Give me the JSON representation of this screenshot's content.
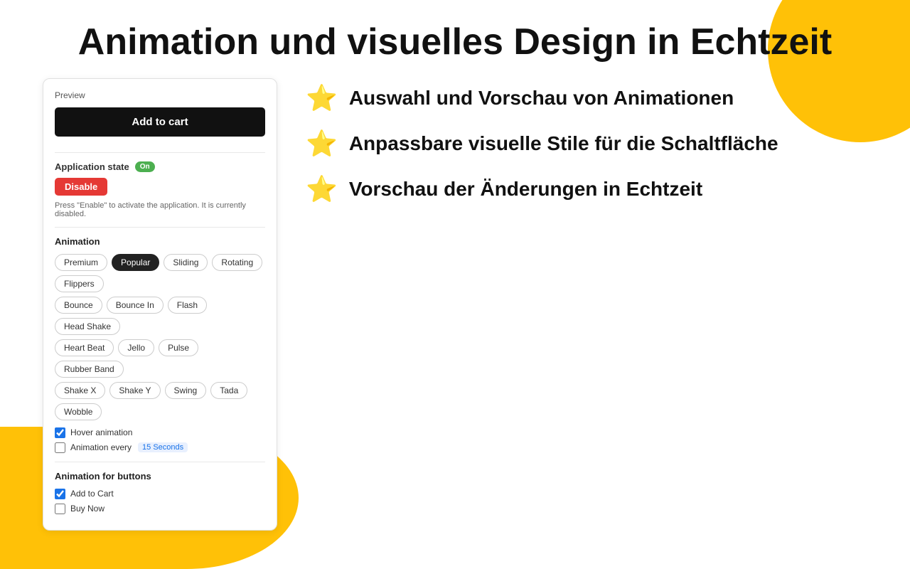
{
  "page": {
    "title": "Animation und visuelles Design in Echtzeit"
  },
  "blob": {
    "top_right": true,
    "bottom_left": true
  },
  "ui_card": {
    "preview_label": "Preview",
    "add_to_cart_label": "Add to cart",
    "application_state": {
      "label": "Application state",
      "badge": "On",
      "disable_button": "Disable",
      "hint": "Press \"Enable\" to activate the application. It is currently disabled."
    },
    "animation_section": {
      "title": "Animation",
      "tabs": [
        {
          "label": "Premium",
          "active": false
        },
        {
          "label": "Popular",
          "active": true
        },
        {
          "label": "Sliding",
          "active": false
        },
        {
          "label": "Rotating",
          "active": false
        },
        {
          "label": "Flippers",
          "active": false
        }
      ],
      "tags_row1": [
        {
          "label": "Bounce",
          "active": false
        },
        {
          "label": "Bounce In",
          "active": false
        },
        {
          "label": "Flash",
          "active": false
        },
        {
          "label": "Head Shake",
          "active": false
        }
      ],
      "tags_row2": [
        {
          "label": "Heart Beat",
          "active": false
        },
        {
          "label": "Jello",
          "active": false
        },
        {
          "label": "Pulse",
          "active": false
        },
        {
          "label": "Rubber Band",
          "active": false
        }
      ],
      "tags_row3": [
        {
          "label": "Shake X",
          "active": false
        },
        {
          "label": "Shake Y",
          "active": false
        },
        {
          "label": "Swing",
          "active": false
        },
        {
          "label": "Tada",
          "active": false
        },
        {
          "label": "Wobble",
          "active": false
        }
      ],
      "hover_animation": {
        "label": "Hover animation",
        "checked": true
      },
      "animation_every": {
        "label": "Animation every",
        "seconds_label": "15 Seconds",
        "checked": false
      }
    },
    "animation_for_buttons": {
      "title": "Animation for buttons",
      "buttons": [
        {
          "label": "Add to Cart",
          "checked": true
        },
        {
          "label": "Buy Now",
          "checked": false
        }
      ]
    }
  },
  "features": [
    {
      "icon": "⭐",
      "text": "Auswahl und Vorschau von Animationen"
    },
    {
      "icon": "⭐",
      "text": "Anpassbare visuelle Stile für die Schaltfläche"
    },
    {
      "icon": "⭐",
      "text": "Vorschau der Änderungen in Echtzeit"
    }
  ]
}
